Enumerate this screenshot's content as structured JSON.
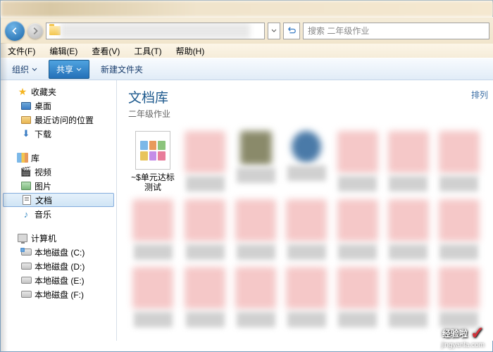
{
  "search": {
    "placeholder": "搜索 二年级作业"
  },
  "menubar": {
    "file": "文件(F)",
    "edit": "编辑(E)",
    "view": "查看(V)",
    "tools": "工具(T)",
    "help": "帮助(H)"
  },
  "toolbar": {
    "organize": "组织",
    "share": "共享",
    "newfolder": "新建文件夹"
  },
  "sidebar": {
    "favorites": "收藏夹",
    "desktop": "桌面",
    "recent": "最近访问的位置",
    "downloads": "下载",
    "libraries": "库",
    "videos": "视频",
    "pictures": "图片",
    "documents": "文档",
    "music": "音乐",
    "computer": "计算机",
    "diskC": "本地磁盘 (C:)",
    "diskD": "本地磁盘 (D:)",
    "diskE": "本地磁盘 (E:)",
    "diskF": "本地磁盘 (F:)"
  },
  "main": {
    "library_title": "文档库",
    "library_sub": "二年级作业",
    "arrange": "排列",
    "file1": "~$单元达标测试"
  },
  "watermark": {
    "text": "经验啦",
    "url": "jingyanla.com"
  }
}
